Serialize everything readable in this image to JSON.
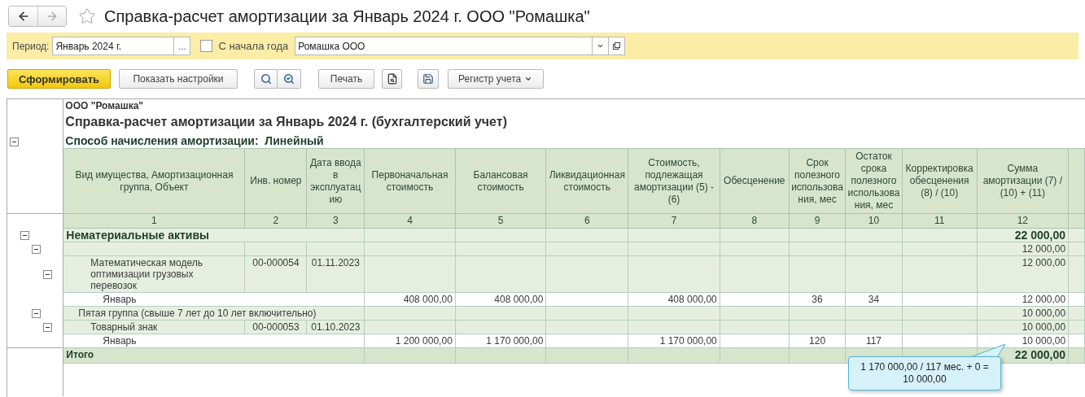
{
  "window": {
    "title": "Справка-расчет амортизации за Январь 2024 г. ООО \"Ромашка\"",
    "favorite": false
  },
  "filters": {
    "period_label": "Период:",
    "period_value": "Январь 2024 г.",
    "period_button": "...",
    "from_year_start": {
      "label": "С начала года",
      "checked": false
    },
    "organization": "Ромашка ООО"
  },
  "toolbar": {
    "generate": "Сформировать",
    "settings": "Показать настройки",
    "print": "Печать",
    "register": "Регистр учета"
  },
  "report": {
    "organization": "ООО \"Ромашка\"",
    "title": "Справка-расчет амортизации за Январь 2024 г. (бухгалтерский учет)",
    "method": "Способ начисления амортизации:  Линейный",
    "columns": [
      {
        "title": "Вид имущества, Амортизационная группа, Объект",
        "number": "1"
      },
      {
        "title": "Инв. номер",
        "number": "2"
      },
      {
        "title": "Дата ввода в эксплуатацию",
        "number": "3"
      },
      {
        "title": "Первоначальная стоимость",
        "number": "4"
      },
      {
        "title": "Балансовая стоимость",
        "number": "5"
      },
      {
        "title": "Ликвидационная стоимость",
        "number": "6"
      },
      {
        "title": "Стоимость, подлежащая амортизации (5) - (6)",
        "number": "7"
      },
      {
        "title": "Обесценение",
        "number": "8"
      },
      {
        "title": "Срок полезного использования, мес",
        "number": "9"
      },
      {
        "title": "Остаток срока полезного использования, мес",
        "number": "10"
      },
      {
        "title": "Корректировка обесценения (8) / (10)",
        "number": "11"
      },
      {
        "title": "Сумма амортизации (7) / (10) + (11)",
        "number": "12"
      }
    ],
    "rows": [
      {
        "kind": "group",
        "label": "Нематериальные активы",
        "expanded": true,
        "values": {
          "12": "22 000,00"
        },
        "children": [
          {
            "kind": "subgroup",
            "expanded": true,
            "values": {
              "12": "12 000,00"
            },
            "children": [
              {
                "kind": "object",
                "label": "Математическая модель оптимизации грузовых перевозок",
                "expanded": true,
                "values": {
                  "2": "00-000054",
                  "3": "01.11.2023",
                  "12": "12 000,00"
                },
                "children": [
                  {
                    "kind": "period",
                    "label": "Январь",
                    "values": {
                      "4": "408 000,00",
                      "5": "408 000,00",
                      "7": "408 000,00",
                      "9": "36",
                      "10": "34",
                      "12": "12 000,00"
                    }
                  }
                ]
              }
            ]
          },
          {
            "kind": "subgroup",
            "label": "Пятая группа (свыше 7 лет до 10 лет включительно)",
            "expanded": true,
            "values": {
              "12": "10 000,00"
            },
            "children": [
              {
                "kind": "object",
                "label": "Товарный знак",
                "expanded": true,
                "values": {
                  "2": "00-000053",
                  "3": "01.10.2023",
                  "12": "10 000,00"
                },
                "children": [
                  {
                    "kind": "period",
                    "label": "Январь",
                    "values": {
                      "4": "1 200 000,00",
                      "5": "1 170 000,00",
                      "7": "1 170 000,00",
                      "9": "120",
                      "10": "117",
                      "12": "10 000,00"
                    }
                  }
                ]
              }
            ]
          }
        ]
      }
    ],
    "total": {
      "label": "Итого",
      "values": {
        "12": "22 000,00"
      }
    },
    "tooltip": "1 170 000,00 / 117 мес. + 0 = 10 000,00"
  }
}
